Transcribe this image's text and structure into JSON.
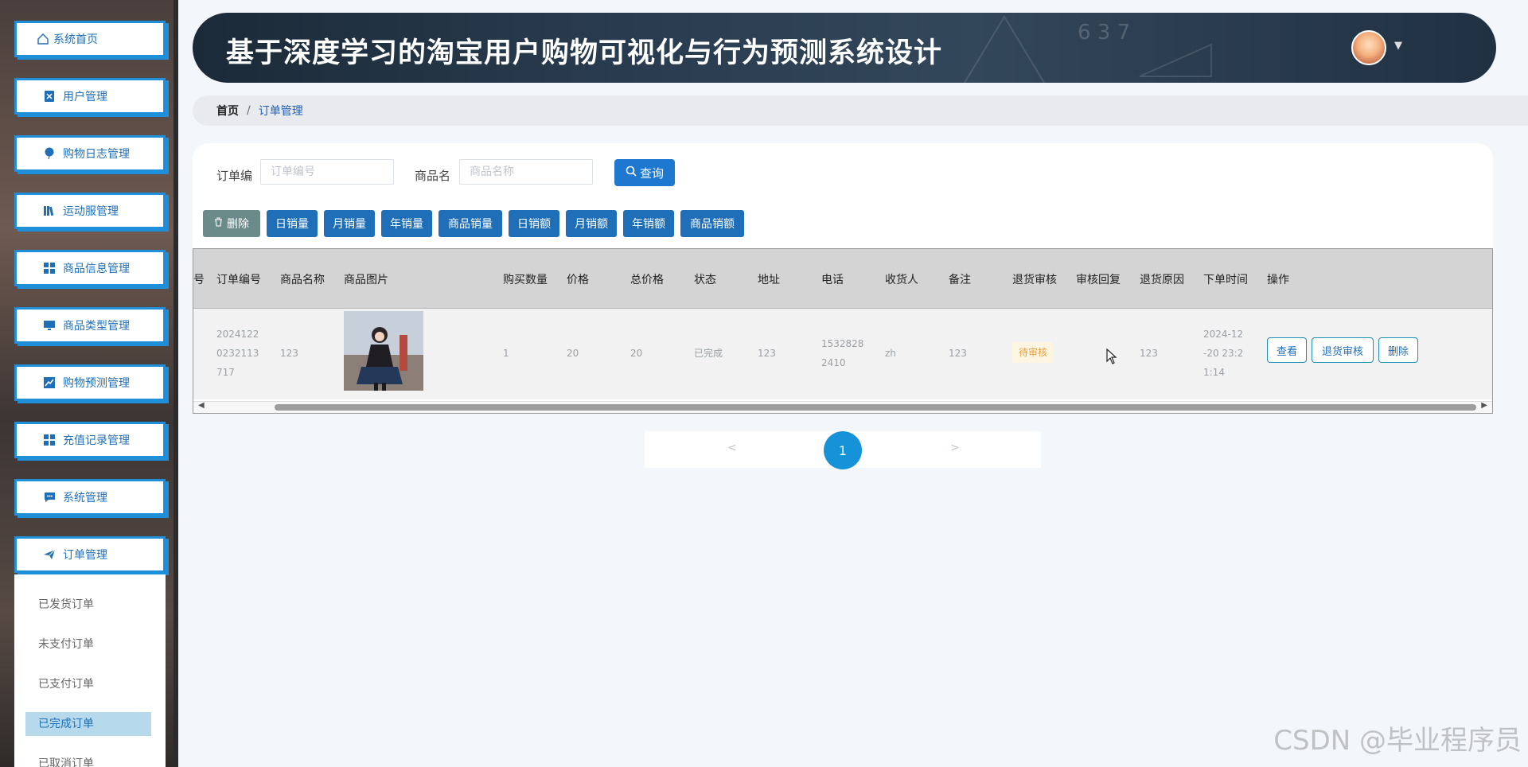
{
  "header": {
    "title": "基于深度学习的淘宝用户购物可视化与行为预测系统设计",
    "deco_digits": "6 3 7"
  },
  "sidebar": {
    "items": [
      {
        "label": "系统首页",
        "icon": "home-icon"
      },
      {
        "label": "用户管理",
        "icon": "user-card-icon"
      },
      {
        "label": "购物日志管理",
        "icon": "balloon-icon"
      },
      {
        "label": "运动服管理",
        "icon": "library-icon"
      },
      {
        "label": "商品信息管理",
        "icon": "grid-icon"
      },
      {
        "label": "商品类型管理",
        "icon": "monitor-icon"
      },
      {
        "label": "购物预测管理",
        "icon": "trend-icon"
      },
      {
        "label": "充值记录管理",
        "icon": "grid-icon"
      },
      {
        "label": "系统管理",
        "icon": "chat-icon"
      },
      {
        "label": "订单管理",
        "icon": "send-icon"
      }
    ],
    "submenu": [
      {
        "label": "已发货订单",
        "active": false
      },
      {
        "label": "未支付订单",
        "active": false
      },
      {
        "label": "已支付订单",
        "active": false
      },
      {
        "label": "已完成订单",
        "active": true
      },
      {
        "label": "已取消订单",
        "active": false
      }
    ]
  },
  "breadcrumb": {
    "home": "首页",
    "separator": "/",
    "current": "订单管理"
  },
  "search": {
    "order_label": "订单编",
    "order_placeholder": "订单编号",
    "product_label": "商品名",
    "product_placeholder": "商品名称",
    "query_label": "查询"
  },
  "toolbar": {
    "delete_label": "删除",
    "buttons": [
      "日销量",
      "月销量",
      "年销量",
      "商品销量",
      "日销额",
      "月销额",
      "年销额",
      "商品销额"
    ]
  },
  "table": {
    "columns": [
      "号",
      "订单编号",
      "商品名称",
      "商品图片",
      "购买数量",
      "价格",
      "总价格",
      "状态",
      "地址",
      "电话",
      "收货人",
      "备注",
      "退货审核",
      "审核回复",
      "退货原因",
      "下单时间",
      "操作"
    ],
    "rows": [
      {
        "order_no": "20241220232113717",
        "product_name": "123",
        "quantity": "1",
        "price": "20",
        "total": "20",
        "status": "已完成",
        "address": "123",
        "phone": "15328282410",
        "receiver": "zh",
        "remark": "123",
        "return_audit": "待审核",
        "audit_reply": "",
        "return_reason": "123",
        "order_time": "2024-12-20 23:21:14",
        "actions": [
          "查看",
          "退货审核",
          "删除"
        ]
      }
    ]
  },
  "pagination": {
    "prev": "<",
    "current": "1",
    "next": ">"
  },
  "watermark": "CSDN @毕业程序员",
  "colors": {
    "primary": "#1e6fb7",
    "sidebar_border": "#1e8fd8",
    "pager_active": "#1592d8",
    "delete_button": "#6b8b8a",
    "badge_text": "#e6a23c"
  }
}
